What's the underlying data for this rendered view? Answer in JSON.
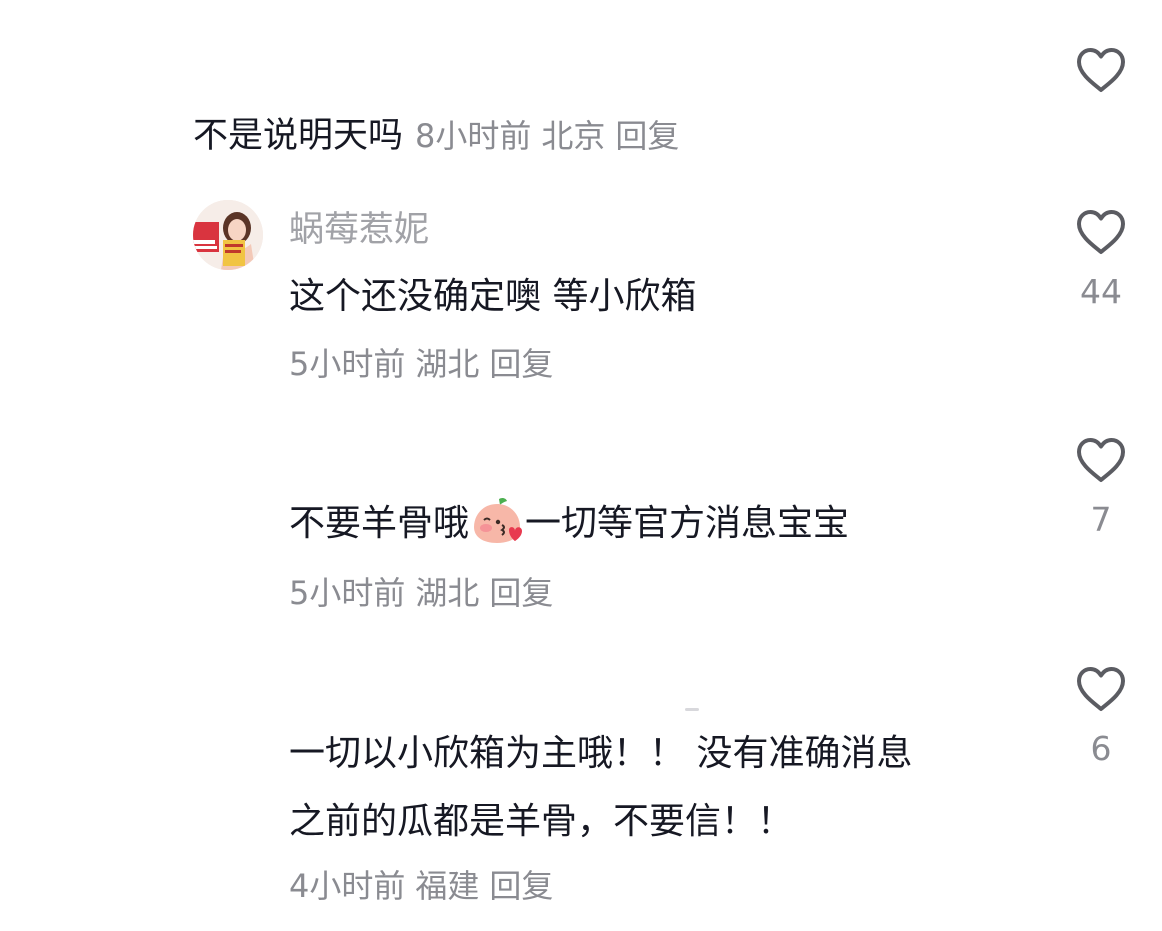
{
  "main_comment": {
    "text": "不是说明天吗",
    "time": "8小时前",
    "location": "北京",
    "reply_label": "回复",
    "like_count": ""
  },
  "replies": [
    {
      "author": "蜗莓惹妮",
      "text": "这个还没确定噢 等小欣箱",
      "time": "5小时前",
      "location": "湖北",
      "reply_label": "回复",
      "like_count": "44"
    },
    {
      "author": "",
      "text_before_emoji": "不要羊骨哦",
      "emoji": "blowing-kiss-peach-emoji",
      "text_after_emoji": "一切等官方消息宝宝",
      "time": "5小时前",
      "location": "湖北",
      "reply_label": "回复",
      "like_count": "7"
    },
    {
      "author": "",
      "text_line1": "一切以小欣箱为主哦！！ 没有准确消息",
      "text_line2": "之前的瓜都是羊骨，不要信！！",
      "time": "4小时前",
      "location": "福建",
      "reply_label": "回复",
      "like_count": "6"
    }
  ],
  "icons": {
    "like": "heart-outline-icon"
  },
  "colors": {
    "text": "#161823",
    "meta": "#8a8b91",
    "author": "#a1a2a7",
    "icon": "#5b5c62"
  }
}
